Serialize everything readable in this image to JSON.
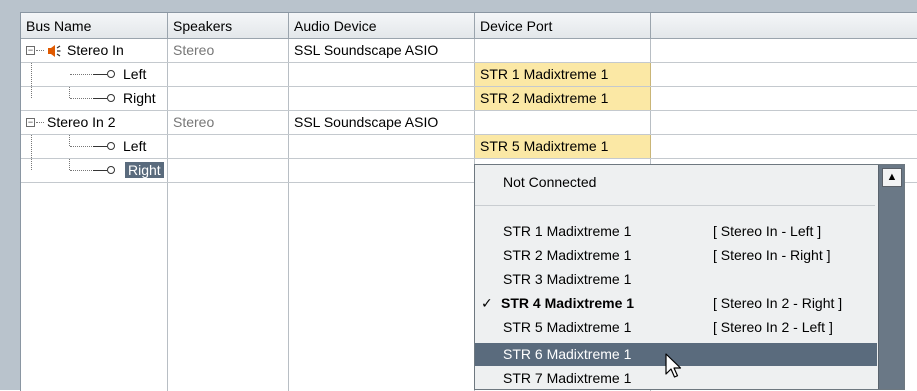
{
  "columns": [
    "Bus Name",
    "Speakers",
    "Audio Device",
    "Device Port"
  ],
  "rows": [
    {
      "bus": "Stereo In",
      "speakers": "Stereo",
      "device": "SSL Soundscape ASIO",
      "port": ""
    },
    {
      "bus": "Left",
      "speakers": "",
      "device": "",
      "port": "STR 1  Madixtreme 1"
    },
    {
      "bus": "Right",
      "speakers": "",
      "device": "",
      "port": "STR 2  Madixtreme 1"
    },
    {
      "bus": "Stereo In 2",
      "speakers": "Stereo",
      "device": "SSL Soundscape ASIO",
      "port": ""
    },
    {
      "bus": "Left",
      "speakers": "",
      "device": "",
      "port": "STR 5  Madixtreme 1"
    },
    {
      "bus": "Right",
      "speakers": "",
      "device": "",
      "port": ""
    }
  ],
  "dropdown": {
    "not_connected": "Not Connected",
    "items": [
      {
        "port": "STR 1  Madixtreme 1",
        "assign": "[ Stereo In - Left ]"
      },
      {
        "port": "STR 2  Madixtreme 1",
        "assign": "[ Stereo In - Right ]"
      },
      {
        "port": "STR 3  Madixtreme 1",
        "assign": ""
      },
      {
        "port": "STR 4  Madixtreme 1",
        "assign": "[ Stereo In 2 - Right ]",
        "checked": true
      },
      {
        "port": "STR 5  Madixtreme 1",
        "assign": "[ Stereo In 2 - Left ]"
      },
      {
        "port": "STR 6  Madixtreme 1",
        "assign": "",
        "highlighted": true
      },
      {
        "port": "STR 7  Madixtreme 1",
        "assign": ""
      }
    ],
    "check_mark": "✓",
    "scroll_up_glyph": "▲"
  },
  "icons": {
    "speaker": "speaker-icon",
    "plug": "plug-icon",
    "cursor": "mouse-cursor-icon"
  },
  "colors": {
    "port_highlight": "#fbe8a5",
    "selection": "#5a6b7d",
    "frame": "#b9c3cc"
  }
}
